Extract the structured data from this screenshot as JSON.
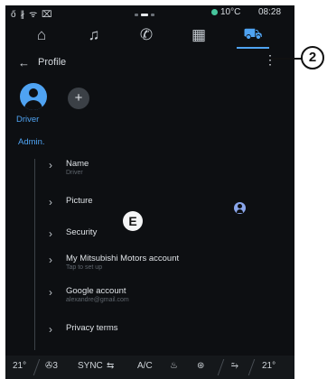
{
  "status_bar": {
    "left_icons": "ő ∦ ᯤ ⌧",
    "temperature": "10°C",
    "time": "08:28"
  },
  "tabs": [
    {
      "name": "home",
      "icon": "home-icon",
      "glyph": "⌂"
    },
    {
      "name": "music",
      "icon": "music-icon",
      "glyph": "♫"
    },
    {
      "name": "phone",
      "icon": "phone-icon",
      "glyph": "✆"
    },
    {
      "name": "apps",
      "icon": "apps-grid-icon",
      "glyph": "▦"
    },
    {
      "name": "car",
      "icon": "car-icon",
      "glyph": "⛟",
      "active": true
    }
  ],
  "header": {
    "back_glyph": "←",
    "title": "Profile",
    "menu_glyph": "⋮"
  },
  "profile": {
    "add_glyph": "+",
    "driver_label": "Driver",
    "admin_label": "Admin."
  },
  "settings": [
    {
      "title": "Name",
      "subtitle": "Driver"
    },
    {
      "title": "Picture",
      "subtitle": ""
    },
    {
      "title": "Security",
      "subtitle": ""
    },
    {
      "title": "My Mitsubishi Motors account",
      "subtitle": "Tap to set up"
    },
    {
      "title": "Google account",
      "subtitle": "alexandre@gmail.com"
    },
    {
      "title": "Privacy terms",
      "subtitle": ""
    }
  ],
  "chevron": "›",
  "bottom_bar": {
    "left_temp": "21°",
    "fan_label": "3",
    "sync": "SYNC",
    "ac": "A/C",
    "right_temp": "21°"
  },
  "annotations": {
    "callout_2": "2",
    "marker_e": "E"
  },
  "colors": {
    "accent": "#4fa3f2",
    "background": "#0d0f12",
    "status_dot": "#46c59c"
  }
}
